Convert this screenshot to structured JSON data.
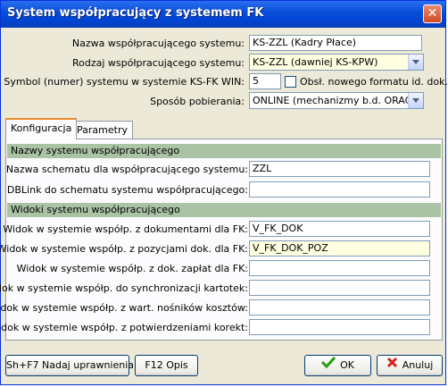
{
  "window": {
    "title": "System współpracujący z systemem FK"
  },
  "top": {
    "name_label": "Nazwa współpracującego systemu:",
    "name_value": "KS-ZZL (Kadry Płace)",
    "kind_label": "Rodzaj współpracującego systemu:",
    "kind_value": "KS-ZZL (dawniej KS-KPW)",
    "symbol_label": "Symbol (numer) systemu w systemie KS-FK WIN:",
    "symbol_value": "5",
    "new_format_label": "Obsł. nowego formatu id. dok.",
    "method_label": "Sposób pobierania:",
    "method_value": "ONLINE (mechanizmy b.d. ORACLE)"
  },
  "tabs": [
    "Konfiguracja",
    "Parametry"
  ],
  "sections": {
    "names": {
      "header": "Nazwy systemu współpracującego",
      "schema_label": "Nazwa schematu dla współpracującego systemu:",
      "schema_value": "ZZL",
      "dblink_label": "DBLink do schematu systemu współpracującego:",
      "dblink_value": ""
    },
    "views": {
      "header": "Widoki systemu współpracującego",
      "rows": [
        {
          "label": "Widok w systemie współp. z dokumentami dla FK:",
          "value": "V_FK_DOK"
        },
        {
          "label": "Widok w systemie współp. z pozycjami dok. dla FK:",
          "value": "V_FK_DOK_POZ"
        },
        {
          "label": "Widok w systemie współp. z dok. zapłat dla FK:",
          "value": ""
        },
        {
          "label": "Widok w systemie współp. do synchronizacji kartotek:",
          "value": ""
        },
        {
          "label": "Widok w systemie współp. z wart. nośników kosztów:",
          "value": ""
        },
        {
          "label": "Widok w systemie współp. z potwierdzeniami korekt:",
          "value": ""
        }
      ]
    }
  },
  "buttons": {
    "grant": "Sh+F7 Nadaj uprawnienia",
    "help": "F12 Opis",
    "ok": "OK",
    "cancel": "Anuluj"
  },
  "colors": {
    "section": "#a9c3a4",
    "highlight": "#ffffe1",
    "titlebar": "#0a4fd8"
  }
}
